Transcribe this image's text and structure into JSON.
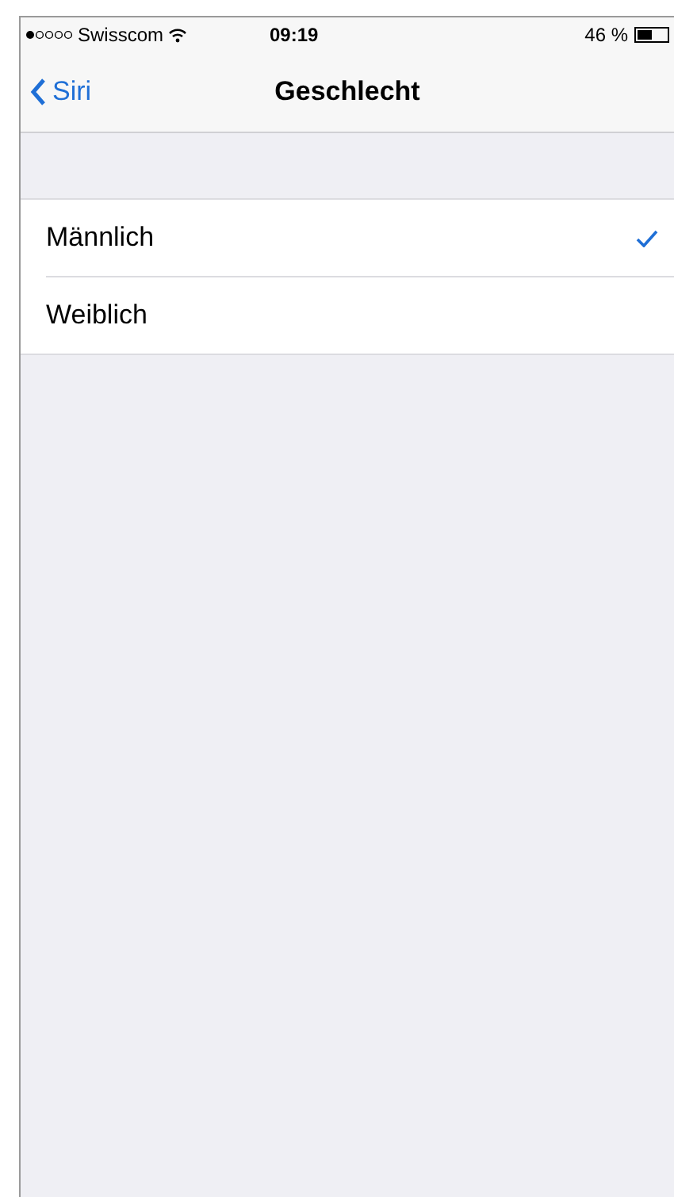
{
  "status_bar": {
    "carrier": "Swisscom",
    "time": "09:19",
    "battery": "46 %"
  },
  "nav_bar": {
    "back": "Siri",
    "title": "Geschlecht"
  },
  "options": [
    {
      "label": "Männlich",
      "selected": true
    },
    {
      "label": "Weiblich",
      "selected": false
    }
  ]
}
